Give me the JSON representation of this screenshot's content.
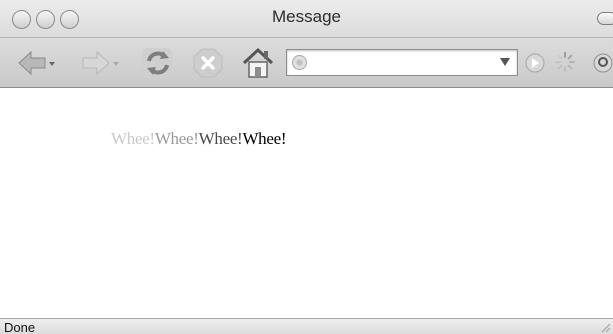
{
  "window": {
    "title": "Message"
  },
  "toolbar": {
    "icons": [
      "back-arrow-icon",
      "forward-arrow-icon",
      "reload-icon",
      "stop-icon",
      "home-icon",
      "go-icon",
      "spinner-icon",
      "search-icon"
    ],
    "url": {
      "value": "",
      "placeholder": ""
    }
  },
  "content": {
    "whee": [
      {
        "text": "Whee!",
        "color": "#c9c9c9"
      },
      {
        "text": "Whee!",
        "color": "#9a9a9a"
      },
      {
        "text": "Whee!",
        "color": "#4a4a4a"
      },
      {
        "text": "Whee!",
        "color": "#000000"
      }
    ]
  },
  "status": {
    "text": "Done"
  }
}
